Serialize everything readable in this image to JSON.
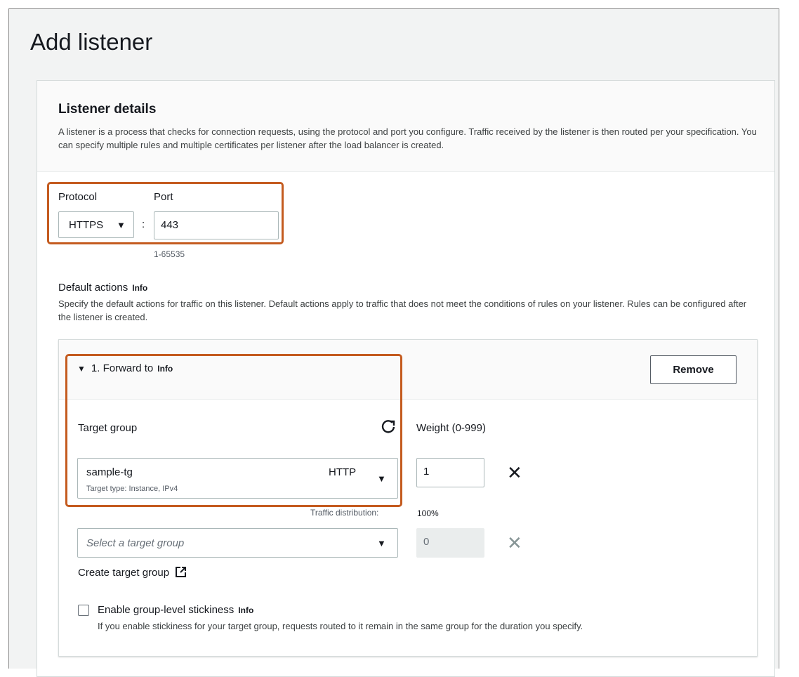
{
  "page": {
    "title": "Add listener"
  },
  "listener_details": {
    "title": "Listener details",
    "description": "A listener is a process that checks for connection requests, using the protocol and port you configure. Traffic received by the listener is then routed per your specification. You can specify multiple rules and multiple certificates per listener after the load balancer is created."
  },
  "protocol": {
    "label": "Protocol",
    "value": "HTTPS",
    "separator": ":"
  },
  "port": {
    "label": "Port",
    "value": "443",
    "hint": "1-65535"
  },
  "default_actions": {
    "label": "Default actions",
    "info": "Info",
    "description": "Specify the default actions for traffic on this listener. Default actions apply to traffic that does not meet the conditions of rules on your listener. Rules can be configured after the listener is created."
  },
  "forward": {
    "title": "1. Forward to",
    "info": "Info",
    "remove_label": "Remove",
    "target_group_label": "Target group",
    "weight_label": "Weight (0-999)",
    "target1": {
      "name": "sample-tg",
      "protocol": "HTTP",
      "subtext": "Target type: Instance, IPv4",
      "weight": "1"
    },
    "traffic_label": "Traffic distribution:",
    "traffic_value": "100%",
    "target2": {
      "placeholder": "Select a target group",
      "weight": "0"
    },
    "create_link": "Create target group"
  },
  "stickiness": {
    "label": "Enable group-level stickiness",
    "info": "Info",
    "description": "If you enable stickiness for your target group, requests routed to it remain in the same group for the duration you specify."
  },
  "icons": {
    "caret": "caret-down-icon",
    "refresh": "refresh-icon",
    "close": "close-icon",
    "external": "external-link-icon"
  },
  "colors": {
    "highlight": "#c45b1f",
    "background": "#f2f3f3",
    "border": "#aab7b8"
  }
}
